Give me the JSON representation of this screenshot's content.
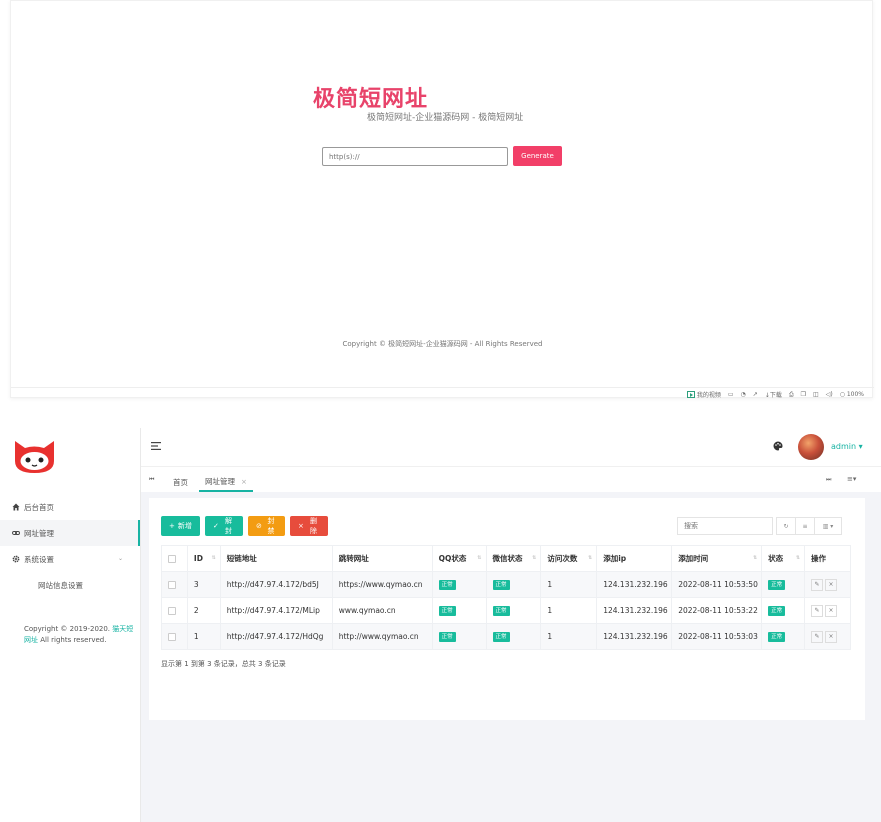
{
  "landing": {
    "title": "极简短网址",
    "subtitle": "极简短网址-企业猫源码网 - 极简短网址",
    "url_placeholder": "http(s)://",
    "generate_label": "Generate",
    "copyright": "Copyright © 极简短网址-企业猫源码网 - All Rights Reserved"
  },
  "status_bar": {
    "items": [
      "我的视频",
      "下载",
      "100%"
    ]
  },
  "sidebar": {
    "items": [
      {
        "label": "后台首页",
        "icon": "home-icon"
      },
      {
        "label": "网址管理",
        "icon": "link-icon"
      },
      {
        "label": "系统设置",
        "icon": "gear-icon"
      }
    ],
    "sub_item": "网站信息设置",
    "copyright_prefix": "Copyright © 2019-2020.",
    "copyright_link": "猫天短网址",
    "copyright_suffix": "All rights reserved."
  },
  "header": {
    "user_name": "admin"
  },
  "tabs": {
    "home": "首页",
    "active": "网址管理",
    "close": "×"
  },
  "toolbar": {
    "add": "新增",
    "unban": "解封",
    "ban": "封禁",
    "delete": "删除",
    "search_placeholder": "搜索"
  },
  "table": {
    "columns": [
      "ID",
      "短链地址",
      "跳转网址",
      "QQ状态",
      "微信状态",
      "访问次数",
      "添加ip",
      "添加时间",
      "状态",
      "操作"
    ],
    "rows": [
      {
        "id": "3",
        "short": "http://d47.97.4.172/bd5J",
        "target": "https://www.qymao.cn",
        "qq": "正常",
        "wx": "正常",
        "visits": "1",
        "ip": "124.131.232.196",
        "time": "2022-08-11 10:53:50",
        "status": "正常"
      },
      {
        "id": "2",
        "short": "http://d47.97.4.172/MLip",
        "target": "www.qymao.cn",
        "qq": "正常",
        "wx": "正常",
        "visits": "1",
        "ip": "124.131.232.196",
        "time": "2022-08-11 10:53:22",
        "status": "正常"
      },
      {
        "id": "1",
        "short": "http://d47.97.4.172/HdQg",
        "target": "http://www.qymao.cn",
        "qq": "正常",
        "wx": "正常",
        "visits": "1",
        "ip": "124.131.232.196",
        "time": "2022-08-11 10:53:03",
        "status": "正常"
      }
    ],
    "summary": "显示第 1 到第 3 条记录，总共 3 条记录"
  },
  "colors": {
    "brand": "#e8436a",
    "generate": "#f23f68",
    "accent": "#17b3a3",
    "success": "#18bc9c",
    "warning": "#f39c12",
    "danger": "#e74c3c"
  }
}
